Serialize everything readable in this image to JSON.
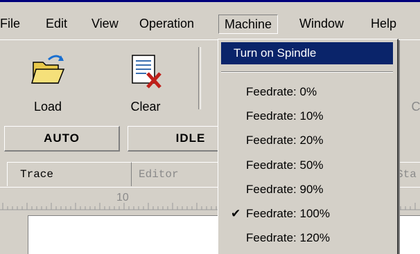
{
  "menubar": {
    "items": [
      {
        "label": "File"
      },
      {
        "label": "Edit"
      },
      {
        "label": "View"
      },
      {
        "label": "Operation"
      },
      {
        "label": "Machine"
      },
      {
        "label": "Window"
      },
      {
        "label": "Help"
      }
    ]
  },
  "toolbar": {
    "load_label": "Load",
    "clear_label": "Clear",
    "partial_label": "C"
  },
  "status": {
    "mode": "AUTO",
    "state": "IDLE"
  },
  "tabs": [
    {
      "label": "Trace"
    },
    {
      "label": "Editor"
    },
    {
      "label": "Sta"
    }
  ],
  "ruler": {
    "mark": "10"
  },
  "machine_menu": {
    "highlighted": "Turn on Spindle",
    "items": [
      {
        "label": "Feedrate: 0%"
      },
      {
        "label": "Feedrate: 10%"
      },
      {
        "label": "Feedrate: 20%"
      },
      {
        "label": "Feedrate: 50%"
      },
      {
        "label": "Feedrate: 90%"
      },
      {
        "label": "Feedrate: 100%",
        "checked": true
      },
      {
        "label": "Feedrate: 120%"
      }
    ]
  },
  "colors": {
    "highlight": "#0a246a",
    "face": "#d4d0c8"
  }
}
